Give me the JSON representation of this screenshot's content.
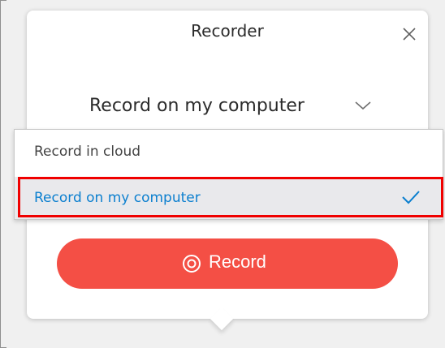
{
  "popover": {
    "title": "Recorder",
    "close_icon": "close-icon"
  },
  "selector": {
    "value": "Record on my computer",
    "chevron_icon": "chevron-down-icon"
  },
  "dropdown": {
    "options": [
      {
        "label": "Record in cloud",
        "selected": false
      },
      {
        "label": "Record on my computer",
        "selected": true
      }
    ],
    "check_icon": "checkmark-icon"
  },
  "record_button": {
    "label": "Record",
    "icon": "record-icon"
  },
  "colors": {
    "accent_blue": "#0b7fcf",
    "record_red": "#f44f45",
    "highlight_red": "#f00000",
    "selected_row_bg": "#e9e9ec"
  }
}
